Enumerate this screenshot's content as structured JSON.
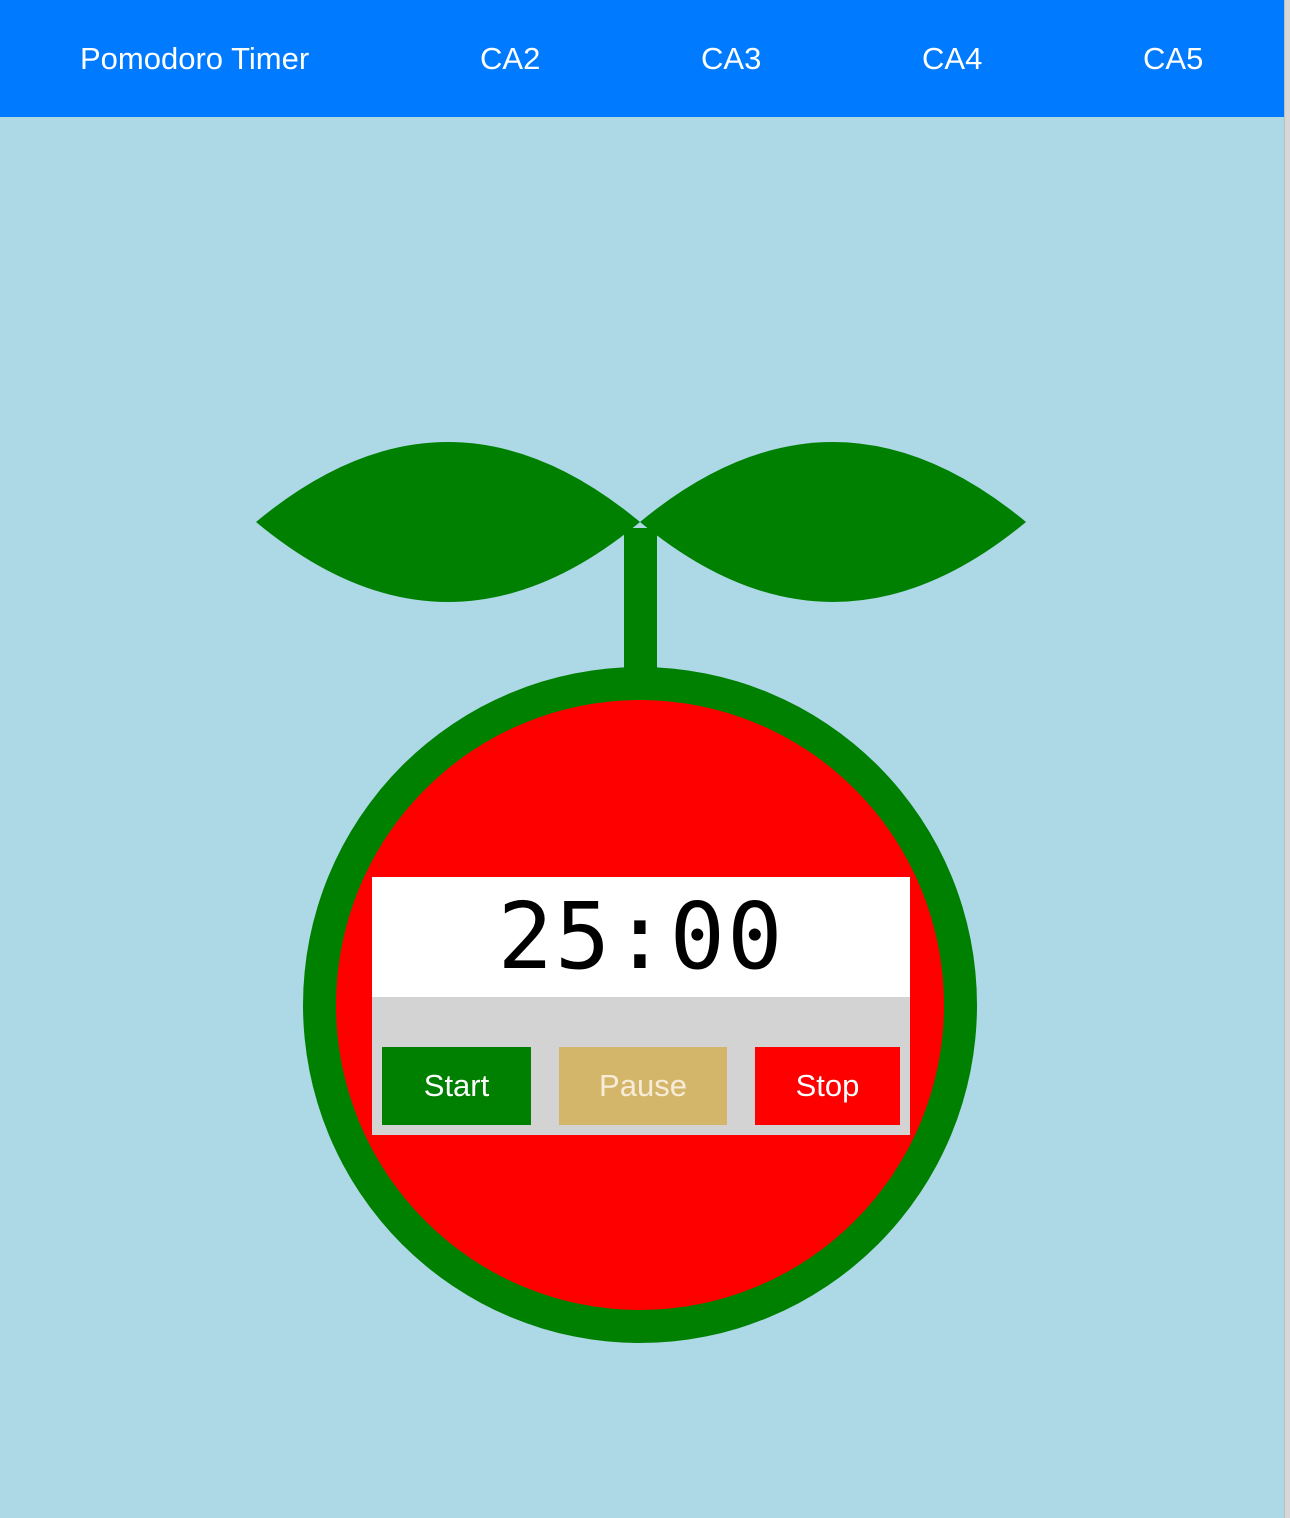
{
  "navbar": {
    "title": "Pomodoro Timer",
    "links": [
      "CA2",
      "CA3",
      "CA4",
      "CA5"
    ],
    "background_color": "#007bff"
  },
  "timer": {
    "display": "25:00",
    "buttons": {
      "start": "Start",
      "pause": "Pause",
      "stop": "Stop"
    }
  },
  "colors": {
    "page_background": "#add8e6",
    "leaf_and_rim": "#008000",
    "tomato_body": "#ff0000",
    "start_button": "#008000",
    "pause_button": "#d4b66b",
    "stop_button": "#ff0000"
  }
}
